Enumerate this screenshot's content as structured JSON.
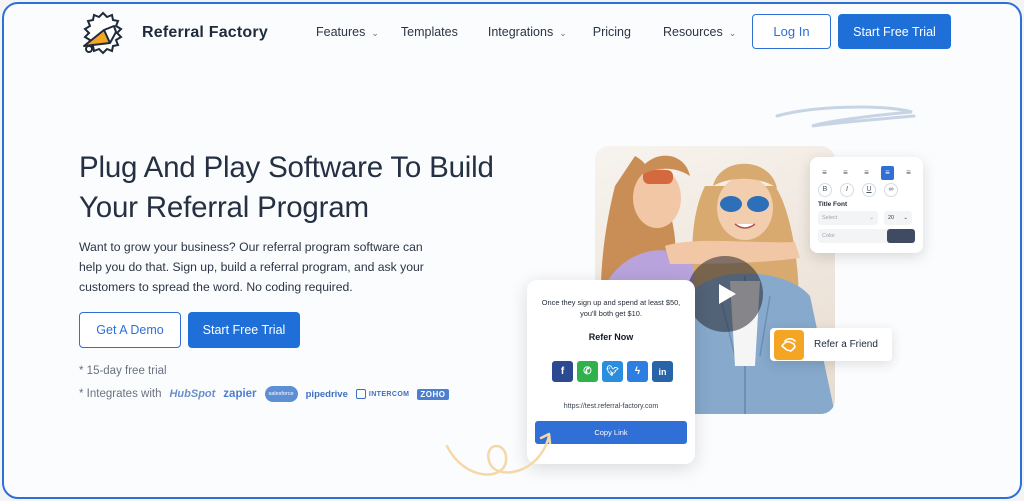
{
  "nav": {
    "brand": "Referral Factory",
    "menu": [
      {
        "label": "Features",
        "has_dropdown": true
      },
      {
        "label": "Templates",
        "has_dropdown": false
      },
      {
        "label": "Integrations",
        "has_dropdown": true
      },
      {
        "label": "Pricing",
        "has_dropdown": false
      },
      {
        "label": "Resources",
        "has_dropdown": true
      }
    ],
    "login_label": "Log In",
    "trial_label": "Start Free Trial"
  },
  "hero": {
    "title": "Plug And Play Software To Build Your Referral Program",
    "description": "Want to grow your business? Our referral program software can help you do that. Sign up, build a referral program, and ask your customers to spread the word. No coding required.",
    "demo_label": "Get A Demo",
    "trial_label": "Start Free Trial",
    "note_trial": "* 15-day free trial",
    "note_integrates": "* Integrates with",
    "integrations": [
      "HubSpot",
      "zapier",
      "salesforce",
      "pipedrive",
      "INTERCOM",
      "ZOHO"
    ]
  },
  "editor": {
    "title_font_label": "Title Font",
    "select_placeholder": "Select",
    "font_size": "20",
    "color_label": "Color",
    "color_value": "#3f4a63",
    "icons": [
      "align-left-icon",
      "align-center-icon",
      "align-right-icon",
      "align-justify-icon",
      "align-distribute-icon",
      "bold-icon",
      "italic-icon",
      "underline-icon",
      "link-icon"
    ]
  },
  "refer_card": {
    "text": "Once they sign up and spend at least $50, you'll both get $10.",
    "title": "Refer Now",
    "share": [
      "facebook",
      "whatsapp",
      "twitter",
      "messenger",
      "linkedin"
    ],
    "url": "https://test.referral-factory.com",
    "copy_label": "Copy Link"
  },
  "refer_friend": {
    "label": "Refer a Friend"
  },
  "colors": {
    "accent": "#1f6fd8",
    "frame_border": "#2f6fd6",
    "refer_icon": "#f5a524"
  }
}
